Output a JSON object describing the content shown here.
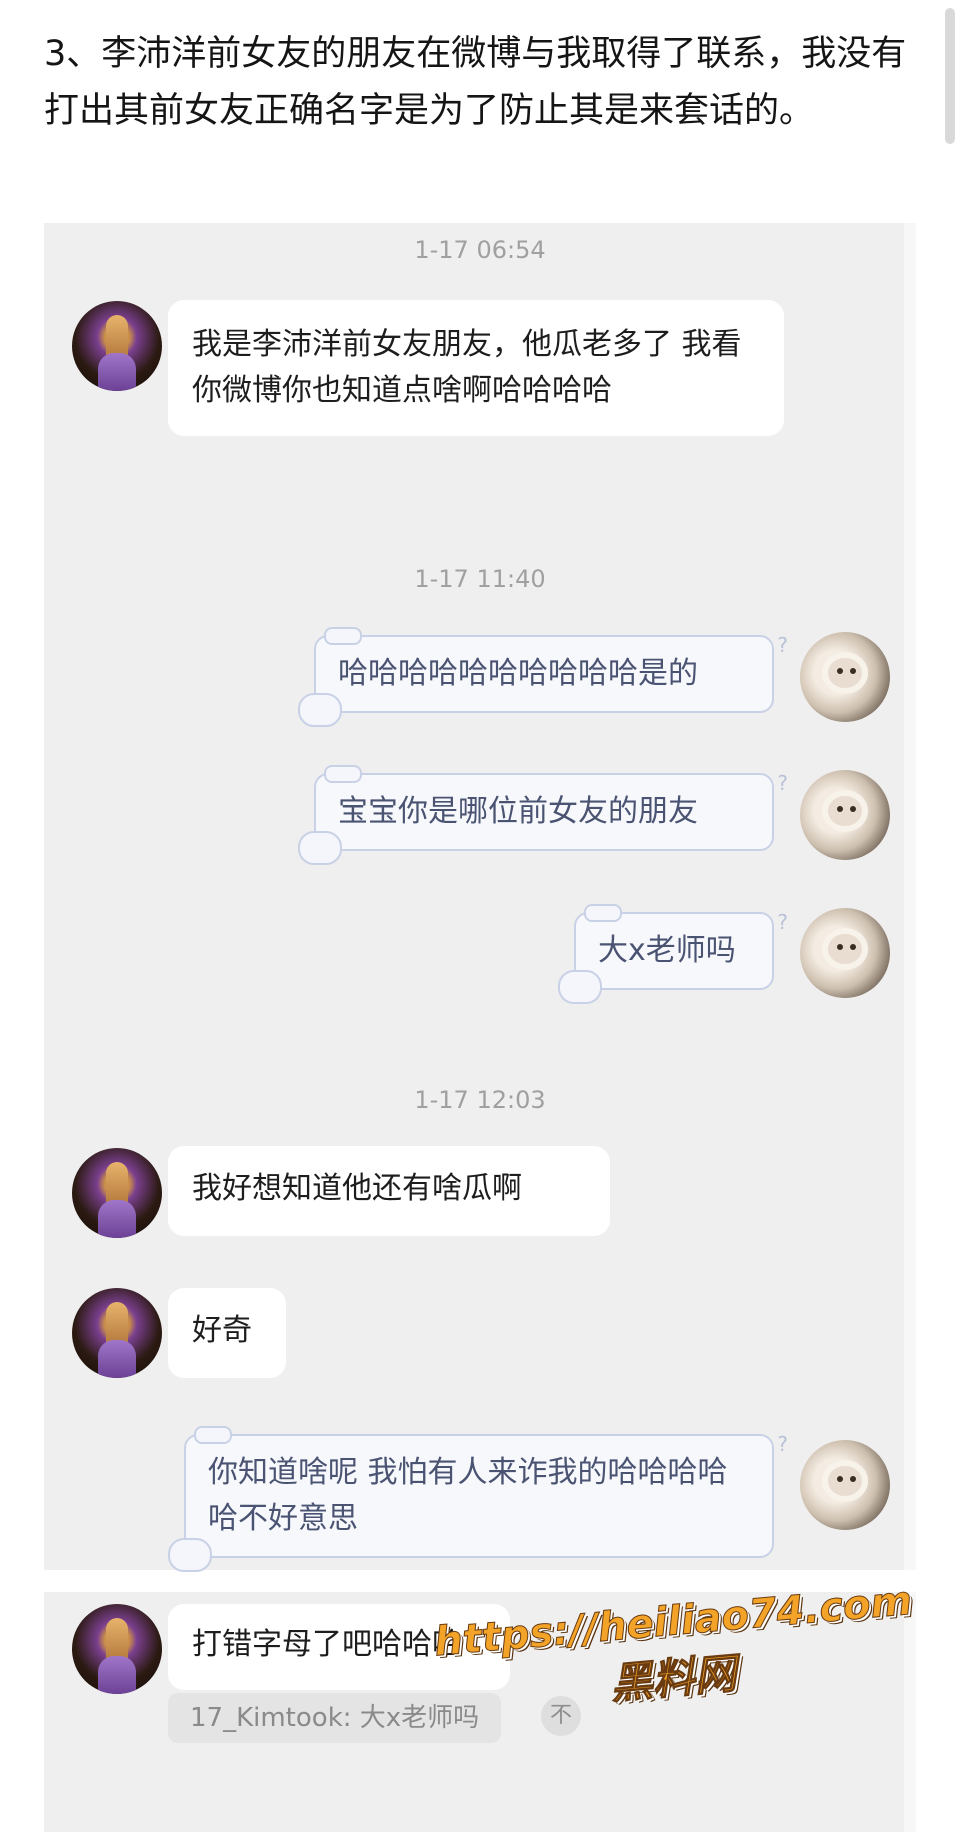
{
  "caption": "3、李沛洋前女友的朋友在微博与我取得了联系，我没有打出其前女友正确名字是为了防止其是来套话的。",
  "chat": {
    "time1": "1-17 06:54",
    "msg1": "我是李沛洋前女友朋友，他瓜老多了 我看你微博你也知道点啥啊哈哈哈哈",
    "time2": "1-17 11:40",
    "msg2": "哈哈哈哈哈哈哈哈哈哈是的",
    "msg3": "宝宝你是哪位前女友的朋友",
    "msg4": "大x老师吗",
    "time3": "1-17 12:03",
    "msg5": "我好想知道他还有啥瓜啊",
    "msg6": "好奇",
    "msg7": "你知道啥呢 我怕有人来诈我的哈哈哈哈哈不好意思",
    "msg8": "打错字母了吧哈哈哈",
    "quote": "17_Kimtook: 大x老师吗",
    "quote_close": "不"
  },
  "watermark": {
    "url": "https://heiliao74.com",
    "name": "黑料网"
  },
  "colors": {
    "panel_bg": "#efefef",
    "incoming_bubble": "#ffffff",
    "outgoing_bubble": "#f7f8fc",
    "outgoing_text": "#4a5472",
    "watermark": "#f2a328"
  }
}
